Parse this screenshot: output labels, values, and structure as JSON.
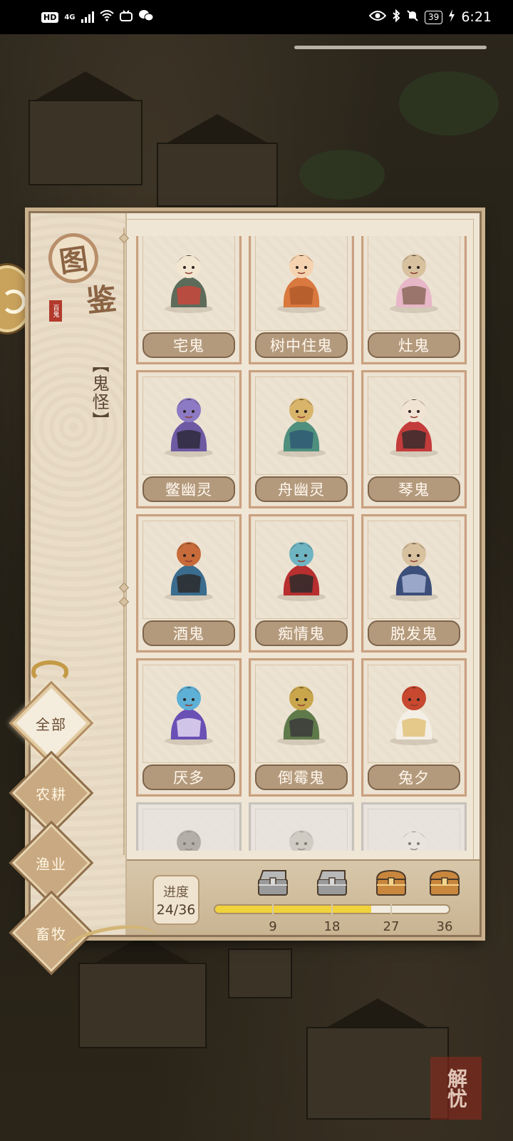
{
  "status_bar": {
    "hd_badge": "HD",
    "network": "4G",
    "battery": "39",
    "time": "6:21"
  },
  "panel": {
    "title_char_1": "图",
    "title_char_2": "鉴",
    "mini_seal_text": "百鬼",
    "category": "【鬼怪】"
  },
  "filter_tabs": [
    {
      "label": "全部",
      "active": true
    },
    {
      "label": "农耕",
      "active": false
    },
    {
      "label": "渔业",
      "active": false
    },
    {
      "label": "畜牧",
      "active": false
    }
  ],
  "cards": [
    {
      "name": "宅鬼"
    },
    {
      "name": "树中住鬼"
    },
    {
      "name": "灶鬼"
    },
    {
      "name": "鳖幽灵"
    },
    {
      "name": "舟幽灵"
    },
    {
      "name": "琴鬼"
    },
    {
      "name": "酒鬼"
    },
    {
      "name": "痴情鬼"
    },
    {
      "name": "脱发鬼"
    },
    {
      "name": "厌多"
    },
    {
      "name": "倒霉鬼"
    },
    {
      "name": "兔夕"
    }
  ],
  "progress": {
    "label": "进度",
    "value": "24/36",
    "current": 24,
    "total": 36,
    "milestones": [
      9,
      18,
      27,
      36
    ],
    "fill_color": "#f0d23c"
  },
  "seal_watermark": "解忧",
  "colors": {
    "panel_bg": "#efe6d6",
    "card_name_bg": "#b49a7d",
    "active_tab": "#f4ecdd",
    "tab": "#c9a981"
  }
}
